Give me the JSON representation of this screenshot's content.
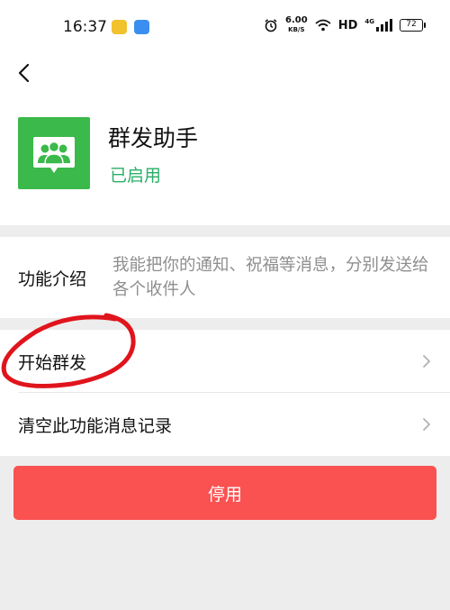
{
  "status_bar": {
    "time": "16:37",
    "net_speed": "6.00",
    "net_speed_unit": "KB/S",
    "network_label": "HD",
    "network_type": "4G",
    "battery": "72",
    "icons": [
      "yellow-app-icon",
      "blue-chat-icon",
      "alarm-icon",
      "wifi-icon",
      "signal-icon",
      "battery-icon"
    ]
  },
  "nav": {
    "back_icon": "chevron-left-icon"
  },
  "header": {
    "app_name": "群发助手",
    "status": "已启用",
    "logo_icon": "group-users-icon"
  },
  "intro": {
    "label": "功能介绍",
    "text": "我能把你的通知、祝福等消息，分别发送给各个收件人"
  },
  "list": {
    "items": [
      {
        "label": "开始群发"
      },
      {
        "label": "清空此功能消息记录"
      }
    ]
  },
  "disable_button": {
    "label": "停用"
  },
  "colors": {
    "logo_green": "#3bb94a",
    "status_green": "#2aae67",
    "button_red": "#fa5151",
    "annotation_red": "#e0141c"
  }
}
